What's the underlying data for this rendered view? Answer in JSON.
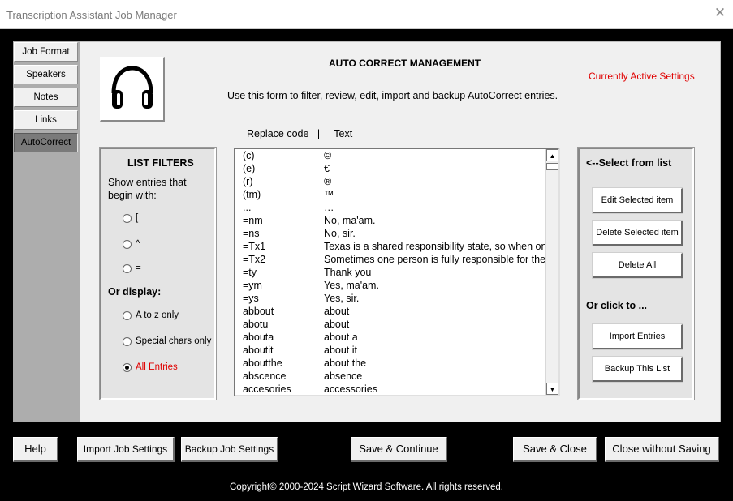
{
  "window": {
    "title": "Transcription Assistant Job Manager"
  },
  "tabs": [
    {
      "label": "Job Format",
      "active": false
    },
    {
      "label": "Speakers",
      "active": false
    },
    {
      "label": "Notes",
      "active": false
    },
    {
      "label": "Links",
      "active": false
    },
    {
      "label": "AutoCorrect",
      "active": true
    }
  ],
  "main": {
    "heading": "AUTO CORRECT MANAGEMENT",
    "active_settings": "Currently Active Settings",
    "instructions": "Use this form to filter, review, edit, import and backup AutoCorrect entries.",
    "column_headers": "Replace code   |     Text"
  },
  "filters": {
    "title": "LIST FILTERS",
    "description": "Show entries that begin with:",
    "begin_options": [
      {
        "label": "[",
        "checked": false
      },
      {
        "label": "^",
        "checked": false
      },
      {
        "label": "=",
        "checked": false
      }
    ],
    "or_display": "Or display:",
    "display_options": [
      {
        "label": "A to z only",
        "checked": false
      },
      {
        "label": "Special chars only",
        "checked": false
      },
      {
        "label": "All  Entries",
        "checked": true
      }
    ]
  },
  "entries": [
    {
      "code": "(c)",
      "text": "©"
    },
    {
      "code": "(e)",
      "text": "€"
    },
    {
      "code": "(r)",
      "text": "®"
    },
    {
      "code": "(tm)",
      "text": "™"
    },
    {
      "code": "...",
      "text": "…"
    },
    {
      "code": "=nm",
      "text": "No, ma'am."
    },
    {
      "code": "=ns",
      "text": "No, sir."
    },
    {
      "code": "=Tx1",
      "text": "Texas is a shared responsibility state, so when one"
    },
    {
      "code": "=Tx2",
      "text": "Sometimes one person is fully responsible for the"
    },
    {
      "code": "=ty",
      "text": "Thank you"
    },
    {
      "code": "=ym",
      "text": "Yes, ma'am."
    },
    {
      "code": "=ys",
      "text": "Yes, sir."
    },
    {
      "code": "abbout",
      "text": "about"
    },
    {
      "code": "abotu",
      "text": "about"
    },
    {
      "code": "abouta",
      "text": "about a"
    },
    {
      "code": "aboutit",
      "text": "about it"
    },
    {
      "code": "aboutthe",
      "text": "about the"
    },
    {
      "code": "abscence",
      "text": "absence"
    },
    {
      "code": "accesories",
      "text": "accessories"
    }
  ],
  "actions": {
    "title": "<--Select from list",
    "edit": "Edit Selected item",
    "delete": "Delete Selected item",
    "delete_all": "Delete All",
    "or_click": "Or click to ...",
    "import": "Import Entries",
    "backup": "Backup This List"
  },
  "bottom": {
    "help": "Help",
    "import_job": "Import Job Settings",
    "backup_job": "Backup Job Settings",
    "save_continue": "Save & Continue",
    "save_close": "Save & Close",
    "close_no_save": "Close without Saving",
    "copyright": "Copyright© 2000-2024 Script Wizard Software.   All rights reserved."
  },
  "icons": {
    "logo": "headphones-icon",
    "close": "close-icon"
  }
}
